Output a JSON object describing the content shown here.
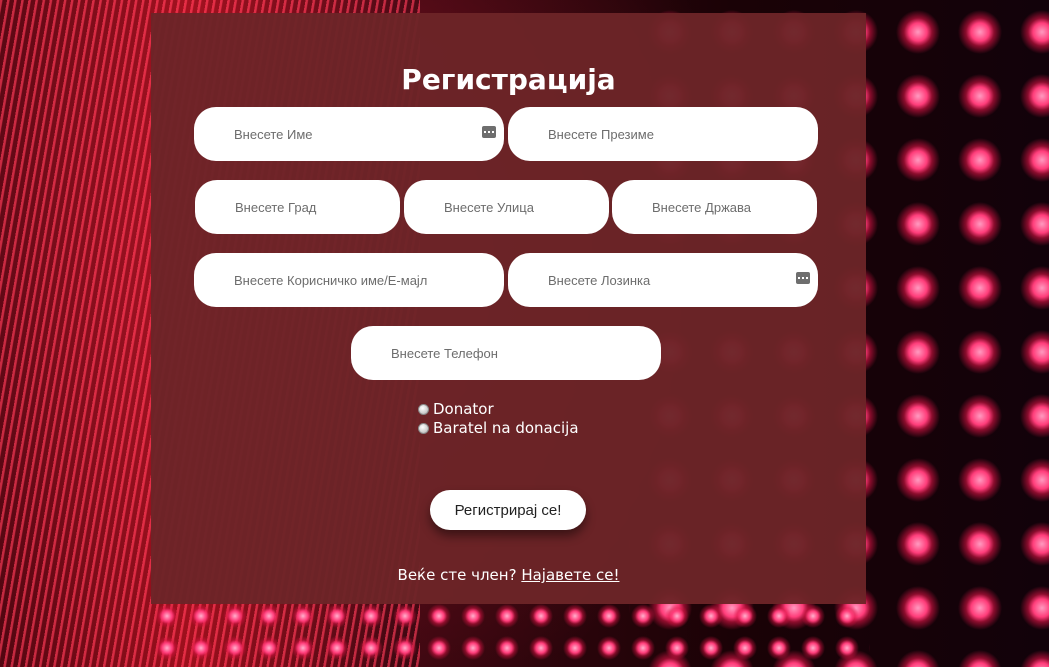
{
  "form": {
    "title": "Регистрација",
    "fields": {
      "first_name": {
        "placeholder": "Внесете Име",
        "value": ""
      },
      "last_name": {
        "placeholder": "Внесете Презиме",
        "value": ""
      },
      "city": {
        "placeholder": "Внесете Град",
        "value": ""
      },
      "street": {
        "placeholder": "Внесете Улица",
        "value": ""
      },
      "country": {
        "placeholder": "Внесете Држава",
        "value": ""
      },
      "username": {
        "placeholder": "Внесете Корисничко име/Е-мајл",
        "value": ""
      },
      "password": {
        "placeholder": "Внесете Лозинка",
        "value": ""
      },
      "phone": {
        "placeholder": "Внесете Телефон",
        "value": ""
      }
    },
    "radio_options": [
      {
        "label": "Donator",
        "selected": false
      },
      {
        "label": "Baratel na donacija",
        "selected": false
      }
    ],
    "submit_label": "Регистрирај се!",
    "login_prompt": "Веќе сте член?",
    "login_link": "Најавете се!"
  },
  "icons": {
    "autofill_key_icon": "key-icon"
  },
  "colors": {
    "panel_background": "#6c2428",
    "text": "#ffffff",
    "field_background": "#ffffff"
  }
}
